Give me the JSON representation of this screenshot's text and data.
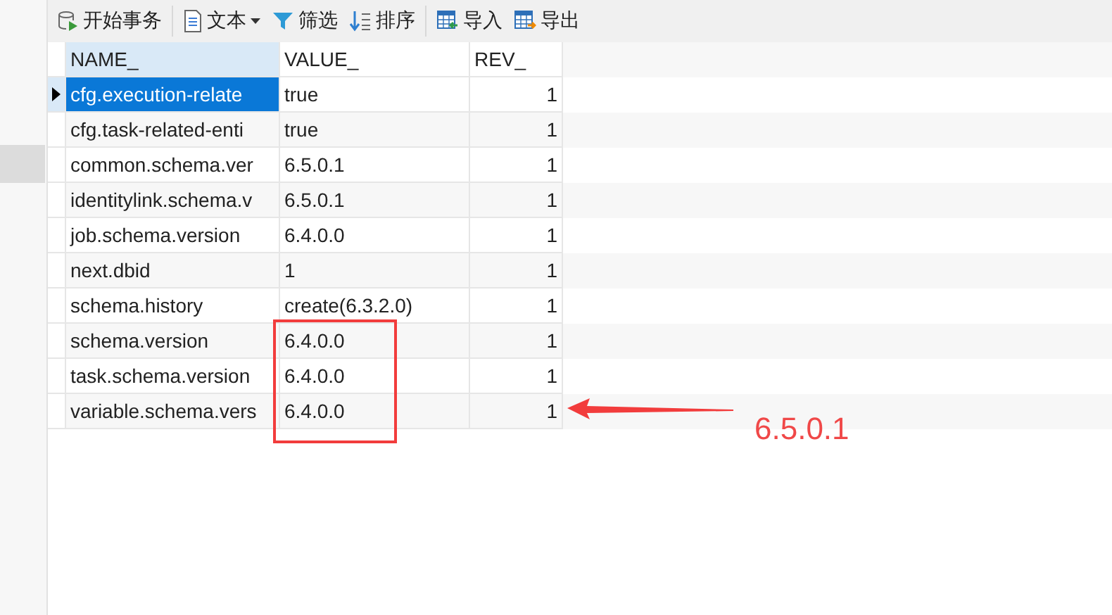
{
  "toolbar": [
    {
      "kind": "transaction",
      "label": "开始事务",
      "dropdown": false
    },
    {
      "kind": "text",
      "label": "文本",
      "dropdown": true
    },
    {
      "kind": "filter",
      "label": "筛选",
      "dropdown": false
    },
    {
      "kind": "sort",
      "label": "排序",
      "dropdown": false
    },
    {
      "kind": "import",
      "label": "导入",
      "dropdown": false
    },
    {
      "kind": "export",
      "label": "导出",
      "dropdown": false
    }
  ],
  "table": {
    "columns": [
      {
        "label": "NAME_",
        "selected": true
      },
      {
        "label": "VALUE_",
        "selected": false
      },
      {
        "label": "REV_",
        "selected": false
      }
    ],
    "rows": [
      {
        "name": "cfg.execution-relate",
        "value": "true",
        "rev": "1",
        "selected": true
      },
      {
        "name": "cfg.task-related-enti",
        "value": "true",
        "rev": "1",
        "selected": false
      },
      {
        "name": "common.schema.ver",
        "value": "6.5.0.1",
        "rev": "1",
        "selected": false
      },
      {
        "name": "identitylink.schema.v",
        "value": "6.5.0.1",
        "rev": "1",
        "selected": false
      },
      {
        "name": "job.schema.version",
        "value": "6.4.0.0",
        "rev": "1",
        "selected": false
      },
      {
        "name": "next.dbid",
        "value": "1",
        "rev": "1",
        "selected": false
      },
      {
        "name": "schema.history",
        "value": "create(6.3.2.0)",
        "rev": "1",
        "selected": false
      },
      {
        "name": "schema.version",
        "value": "6.4.0.0",
        "rev": "1",
        "selected": false
      },
      {
        "name": "task.schema.version",
        "value": "6.4.0.0",
        "rev": "1",
        "selected": false
      },
      {
        "name": "variable.schema.vers",
        "value": "6.4.0.0",
        "rev": "1",
        "selected": false
      }
    ]
  },
  "annotation": {
    "text": "6.5.0.1"
  }
}
